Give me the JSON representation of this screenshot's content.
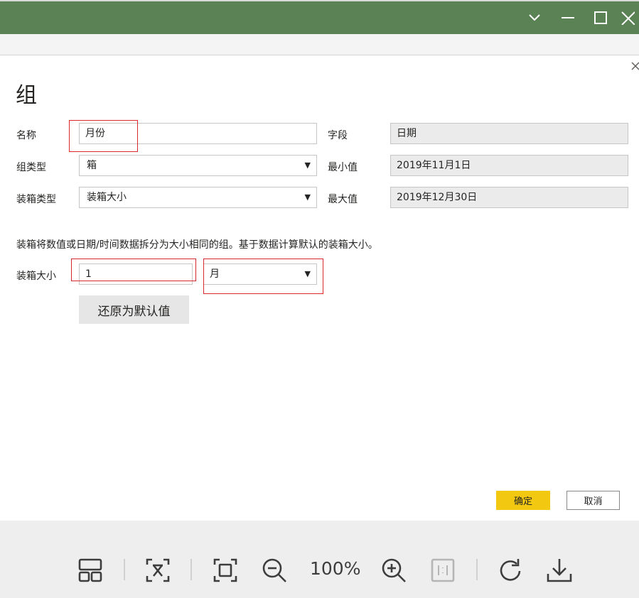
{
  "dialog": {
    "title": "组",
    "name_label": "名称",
    "name_value": "月份",
    "field_label": "字段",
    "field_value": "日期",
    "group_type_label": "组类型",
    "group_type_value": "箱",
    "min_label": "最小值",
    "min_value": "2019年11月1日",
    "bin_type_label": "装箱类型",
    "bin_type_value": "装箱大小",
    "max_label": "最大值",
    "max_value": "2019年12月30日",
    "description": "装箱将数值或日期/时间数据拆分为大小相同的组。基于数据计算默认的装箱大小。",
    "bin_size_label": "装箱大小",
    "bin_size_value": "1",
    "bin_unit_value": "月",
    "reset_label": "还原为默认值",
    "ok_label": "确定",
    "cancel_label": "取消"
  },
  "viewer": {
    "zoom_text": "100%",
    "tools": [
      "layout-icon",
      "fit-text-icon",
      "fit-frame-icon",
      "zoom-out-icon",
      "zoom-in-icon",
      "actual-size-icon",
      "rotate-icon",
      "download-icon"
    ]
  },
  "colors": {
    "titlebar": "#5a8254",
    "ok_button": "#f2c811",
    "highlight": "#e0272c"
  }
}
